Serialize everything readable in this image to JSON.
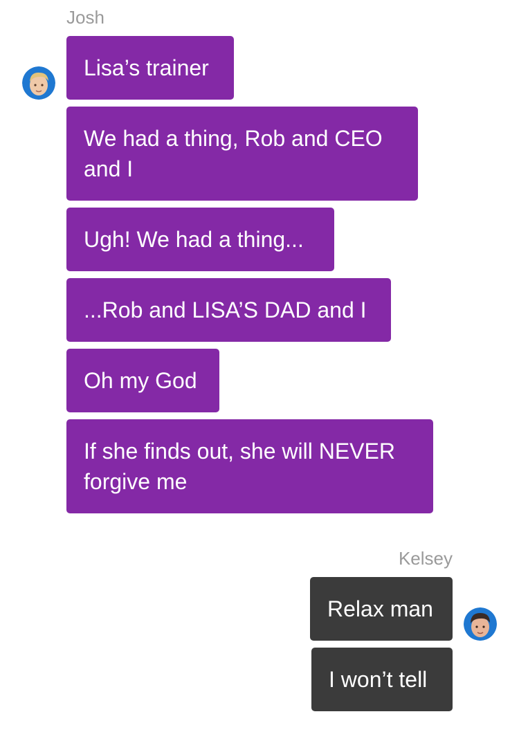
{
  "conversation": {
    "incoming": {
      "sender": "Josh",
      "avatar_icon": "josh-avatar-icon",
      "bubble_color": "#8429a6",
      "messages": [
        "Lisa’s trainer",
        "We had a thing, Rob and CEO and I",
        "Ugh! We had a thing...",
        "...Rob and LISA’S DAD and I",
        "Oh my God",
        "If she finds out, she will NEVER forgive me"
      ]
    },
    "outgoing": {
      "sender": "Kelsey",
      "avatar_icon": "kelsey-avatar-icon",
      "bubble_color": "#3b3b3b",
      "messages": [
        "Relax man",
        "I won’t tell"
      ]
    }
  }
}
